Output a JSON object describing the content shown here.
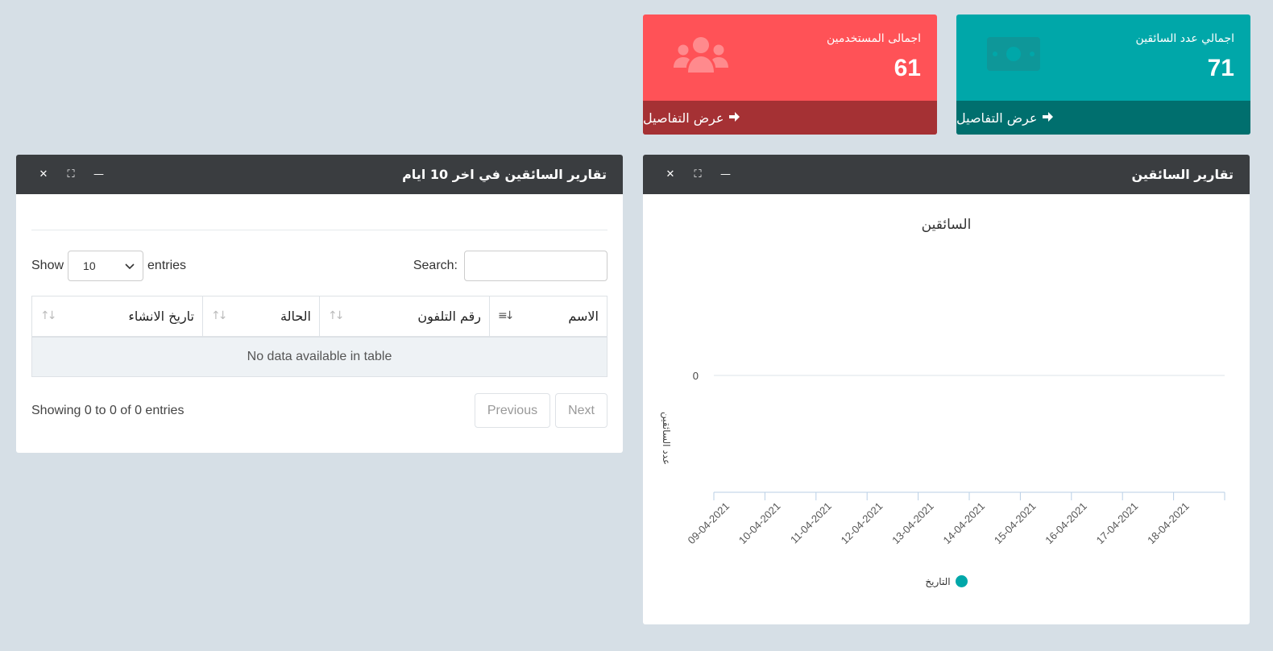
{
  "stats": [
    {
      "label": "اجمالي عدد السائقين",
      "value": "71",
      "footer": "عرض التفاصيل",
      "icon": "money-icon",
      "color": "#00a7a9"
    },
    {
      "label": "اجمالى المستخدمين",
      "value": "61",
      "footer": "عرض التفاصيل",
      "icon": "users-icon",
      "color": "#ff5257"
    }
  ],
  "table_card": {
    "title": "تقارير السائقين في اخر 10 ايام",
    "show_label": "Show",
    "entries_label": "entries",
    "page_size": "10",
    "search_label": "Search:",
    "search_value": "",
    "columns": [
      "الاسم",
      "رقم التلفون",
      "الحالة",
      "تاريخ الانشاء"
    ],
    "empty_text": "No data available in table",
    "info": "Showing 0 to 0 of 0 entries",
    "prev": "Previous",
    "next": "Next"
  },
  "chart_card": {
    "title": "تقارير السائقين"
  },
  "chart_data": {
    "type": "line",
    "title": "السائقين",
    "ylabel": "عدد السائقين",
    "xlabel": "",
    "y_ticks": [
      "0"
    ],
    "categories": [
      "09-04-2021",
      "10-04-2021",
      "11-04-2021",
      "12-04-2021",
      "13-04-2021",
      "14-04-2021",
      "15-04-2021",
      "16-04-2021",
      "17-04-2021",
      "18-04-2021"
    ],
    "series": [
      {
        "name": "التاريخ",
        "values": [],
        "color": "#00a7a9"
      }
    ]
  }
}
